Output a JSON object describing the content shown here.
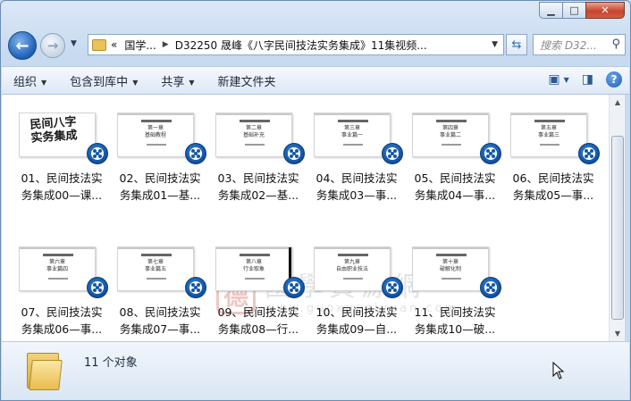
{
  "address": {
    "crumb1": "国学...",
    "crumb2": "D32250 晟峰《八字民间技法实务集成》11集视频...",
    "overflow": "«"
  },
  "search": {
    "placeholder": "搜索 D32..."
  },
  "toolbar": {
    "organize": "组织",
    "include": "包含到库中",
    "share": "共享",
    "new_folder": "新建文件夹"
  },
  "files": [
    {
      "line1": "01、民间技法实",
      "line2": "务集成00—课...",
      "thumb": "民间八字\n实务集成",
      "kind": "cover"
    },
    {
      "line1": "02、民间技法实",
      "line2": "务集成01—基...",
      "thumb": "第一章\n基础教程",
      "kind": "slide"
    },
    {
      "line1": "03、民间技法实",
      "line2": "务集成02—基...",
      "thumb": "第二章\n基础补充",
      "kind": "slide"
    },
    {
      "line1": "04、民间技法实",
      "line2": "务集成03—事...",
      "thumb": "第三章\n事业篇一",
      "kind": "slide"
    },
    {
      "line1": "05、民间技法实",
      "line2": "务集成04—事...",
      "thumb": "第四章\n事业篇二",
      "kind": "slide"
    },
    {
      "line1": "06、民间技法实",
      "line2": "务集成05—事...",
      "thumb": "第五章\n事业篇三",
      "kind": "slide"
    },
    {
      "line1": "07、民间技法实",
      "line2": "务集成06—事...",
      "thumb": "第六章\n事业篇四",
      "kind": "slide"
    },
    {
      "line1": "08、民间技法实",
      "line2": "务集成07—事...",
      "thumb": "第七章\n事业篇五",
      "kind": "slide"
    },
    {
      "line1": "09、民间技法实",
      "line2": "务集成08—行...",
      "thumb": "第八章\n行业取象",
      "kind": "slide-edge"
    },
    {
      "line1": "10、民间技法实",
      "line2": "务集成09—自...",
      "thumb": "第九章\n自由职业技法",
      "kind": "slide"
    },
    {
      "line1": "11、民间技法实",
      "line2": "务集成10—破...",
      "thumb": "第十章\n破解化制",
      "kind": "slide"
    }
  ],
  "watermark": {
    "seal": "德",
    "text": "國學資源網",
    "url": "www.guoxueziyuan.com"
  },
  "status": {
    "count": "11 个对象"
  },
  "icons": {
    "back": "back-arrow-icon",
    "forward": "forward-arrow-icon",
    "refresh": "refresh-icon",
    "search": "search-icon",
    "view": "view-options-icon",
    "preview": "preview-pane-icon",
    "help": "help-icon"
  },
  "colors": {
    "accent": "#1d5fb7",
    "close": "#c6462f",
    "badge": "#0e4f9e"
  }
}
